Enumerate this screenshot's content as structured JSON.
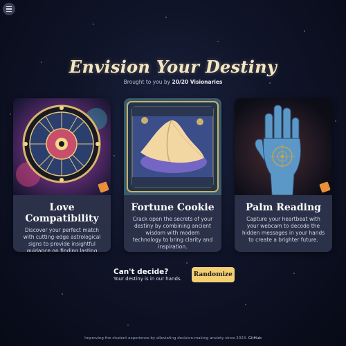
{
  "hero": {
    "title": "Envision Your Destiny",
    "subtitle_prefix": "Brought to you by",
    "subtitle_brand": "20/20 Visionaries"
  },
  "cards": [
    {
      "title": "Love Compatibility",
      "description": "Discover your perfect match with cutting-edge astrological signs to provide insightful guidance on finding lasting love."
    },
    {
      "title": "Fortune Cookie",
      "description": "Crack open the secrets of your destiny by combining ancient wisdom with modern technology to bring clarity and inspiration."
    },
    {
      "title": "Palm Reading",
      "description": "Capture your heartbeat with your webcam to decode the hidden messages in your hands to create a brighter future."
    }
  ],
  "cta": {
    "heading": "Can't decide?",
    "subtext": "Your destiny is in our hands.",
    "button_label": "Randomize"
  },
  "footer": {
    "text": "Improving the student experience by alleviating decision-making anxiety since 2023.",
    "link_label": "GitHub"
  },
  "icons": {
    "menu": "hamburger-menu-icon",
    "card_badge": "pencil-badge-icon"
  },
  "colors": {
    "button_accent": "#f2cf73",
    "card_background": "#2a3149",
    "title_gold": "#f3e6c4"
  }
}
